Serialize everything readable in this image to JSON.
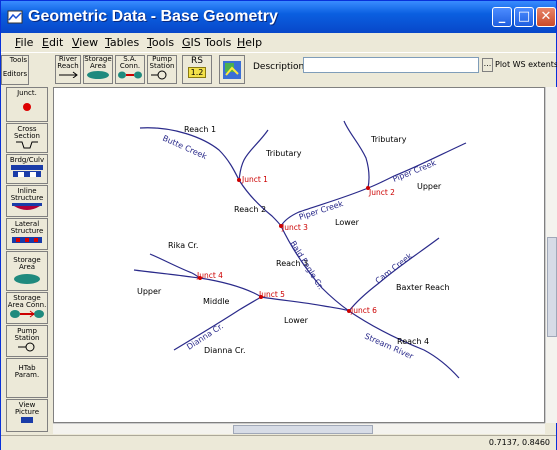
{
  "window": {
    "title": "Geometric Data - Base Geometry"
  },
  "menu": {
    "items": [
      {
        "ul": "F",
        "rest": "ile"
      },
      {
        "ul": "E",
        "rest": "dit"
      },
      {
        "ul": "V",
        "rest": "iew"
      },
      {
        "ul": "T",
        "rest": "ables"
      },
      {
        "ul": "T",
        "rest": "ools"
      },
      {
        "ul": "G",
        "rest": "IS Tools"
      },
      {
        "ul": "H",
        "rest": "elp"
      }
    ]
  },
  "toolbar": {
    "editors_tab": "Editors",
    "tools_tab": "Tools",
    "river_reach": "River Reach",
    "storage_area": "Storage Area",
    "sa_conn": "S.A. Conn.",
    "pump_station": "Pump Station",
    "rs_label": "RS",
    "rs_value": "1.2",
    "description_label": "Description :",
    "description_value": "",
    "more_button": "...",
    "plot_ws": "Plot WS extents"
  },
  "sidebar": {
    "junct": "Junct.",
    "cross_section": "Cross Section",
    "brdg_culv": "Brdg/Culv",
    "inline_structure": "Inline Structure",
    "lateral_structure": "Lateral Structure",
    "storage_area": "Storage Area",
    "storage_area_conn": "Storage Area Conn.",
    "pump_station": "Pump Station",
    "htab_param": "HTab Param.",
    "view_picture": "View Picture"
  },
  "map": {
    "reach_labels": [
      "Reach 1",
      "Tributary",
      "Tributary",
      "Upper",
      "Reach 2",
      "Lower",
      "Reach 3",
      "Rika Cr.",
      "Upper",
      "Middle",
      "Baxter Reach",
      "Lower",
      "Reach 4",
      "Dianna Cr."
    ],
    "junction_labels": [
      "Junct 1",
      "Junct 2",
      "Junct 3",
      "Junct 4",
      "Junct 5",
      "Junct 6"
    ],
    "river_labels": [
      "Butte Creek",
      "Piper Creek",
      "Piper Creek",
      "Cam Creek",
      "Bald Eagle Cr.",
      "Dianna Cr.",
      "Stream River"
    ]
  },
  "status": {
    "coordinates": "0.7137, 0.8460"
  },
  "colors": {
    "river": "#2a2a8a",
    "junction": "#cc0000",
    "titlebar": "#0a5fe0"
  }
}
